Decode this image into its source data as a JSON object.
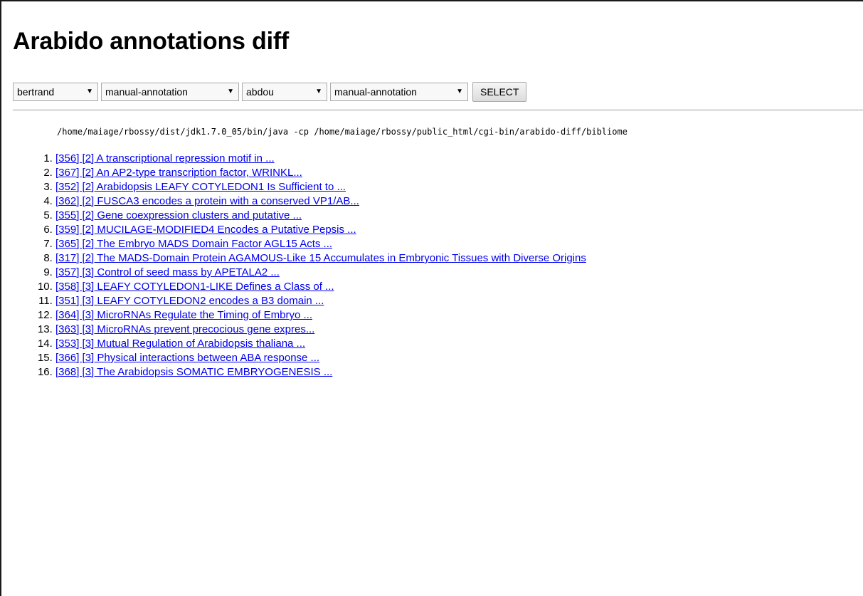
{
  "page_title": "Arabido annotations diff",
  "controls": {
    "user1": "bertrand",
    "set1": "manual-annotation",
    "user2": "abdou",
    "set2": "manual-annotation",
    "select_label": "SELECT"
  },
  "command": "/home/maiage/rbossy/dist/jdk1.7.0_05/bin/java -cp /home/maiage/rbossy/public_html/cgi-bin/arabido-diff/bibliome",
  "links": [
    "[356] [2] A transcriptional repression motif in ...",
    "[367] [2] An AP2-type transcription factor, WRINKL...",
    "[352] [2] Arabidopsis LEAFY COTYLEDON1 Is Sufficient to ...",
    "[362] [2] FUSCA3 encodes a protein with a conserved VP1/AB...",
    "[355] [2] Gene coexpression clusters and putative ...",
    "[359] [2] MUCILAGE-MODIFIED4 Encodes a Putative Pepsis ...",
    "[365] [2] The Embryo MADS Domain Factor AGL15 Acts ...",
    "[317] [2] The MADS-Domain Protein AGAMOUS-Like 15 Accumulates in Embryonic Tissues with Diverse Origins",
    "[357] [3] Control of seed mass by APETALA2 ...",
    "[358] [3] LEAFY COTYLEDON1-LIKE Defines a Class of ...",
    "[351] [3] LEAFY COTYLEDON2 encodes a B3 domain ...",
    "[364] [3] MicroRNAs Regulate the Timing of Embryo ...",
    "[363] [3] MicroRNAs prevent precocious gene expres...",
    "[353] [3] Mutual Regulation of Arabidopsis thaliana ...",
    "[366] [3] Physical interactions between ABA response ...",
    "[368] [3] The Arabidopsis SOMATIC EMBRYOGENESIS ..."
  ]
}
